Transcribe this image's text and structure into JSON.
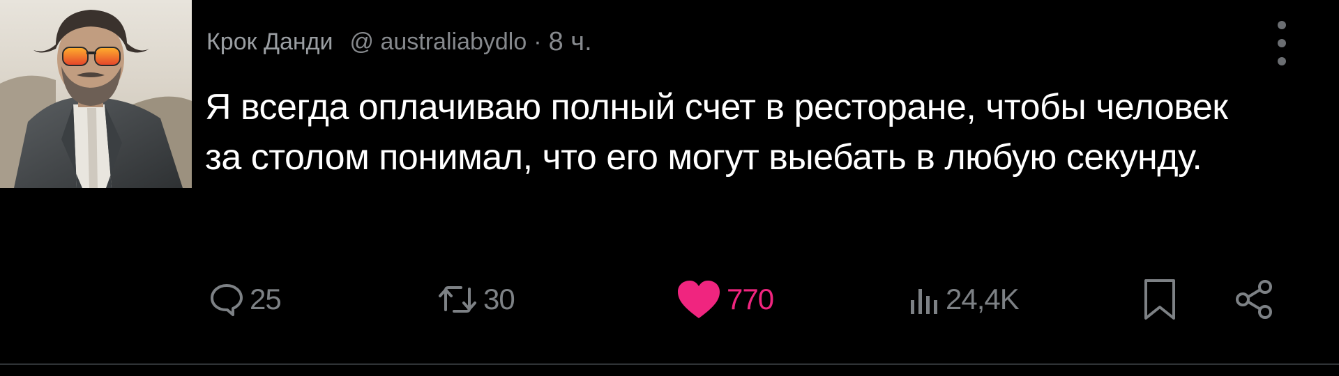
{
  "post": {
    "author": {
      "display_name": "Крок Данди",
      "handle": "@ australiabydlo",
      "separator": "·",
      "time": "8 ч."
    },
    "text": "Я всегда оплачиваю полный счет в ресторане, чтобы человек за столом понимал, что его могут выебать в любую секунду.",
    "actions": {
      "replies": "25",
      "reposts": "30",
      "likes": "770",
      "views": "24,4K"
    },
    "like_state": "liked",
    "colors": {
      "background": "#000000",
      "text": "#ffffff",
      "muted": "#7d8185",
      "like_accent": "#f0257f"
    },
    "icons": {
      "reply": "speech-bubble-icon",
      "repost": "repost-arrows-icon",
      "like": "heart-icon",
      "views": "bar-chart-icon",
      "bookmark": "bookmark-icon",
      "share": "share-nodes-icon",
      "more": "more-vertical-icon"
    }
  }
}
